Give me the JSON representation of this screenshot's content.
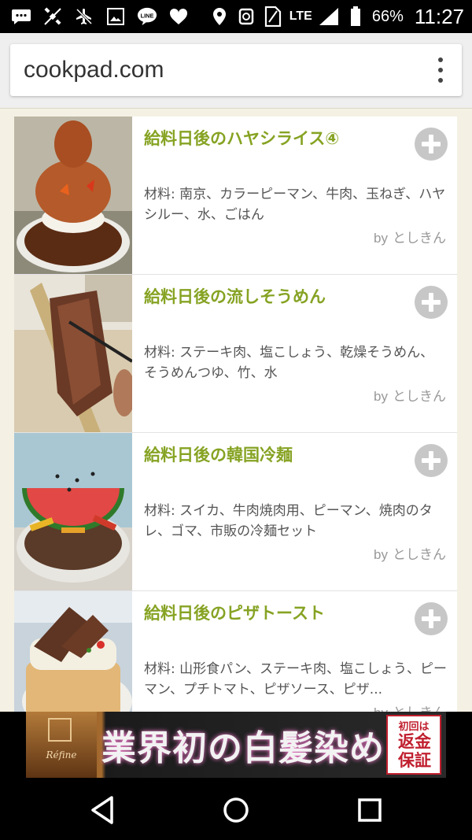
{
  "status_bar": {
    "network": "LTE",
    "battery": "66%",
    "time": "11:27",
    "icons_left": [
      "message-icon",
      "satellite-icon",
      "airplane-off-icon",
      "image-icon",
      "line-icon",
      "heart-icon"
    ],
    "icons_right": [
      "location-icon",
      "alarm-icon",
      "sim-icon",
      "signal-icon",
      "battery-icon"
    ]
  },
  "browser": {
    "url": "cookpad.com",
    "menu_icon": "overflow-menu-icon"
  },
  "recipes": [
    {
      "title": "給料日後のハヤシライス④",
      "ingredients": "材料: 南京、カラーピーマン、牛肉、玉ねぎ、ハヤシルー、水、ごはん",
      "by_label": "by",
      "author": "としきん"
    },
    {
      "title": "給料日後の流しそうめん",
      "ingredients": "材料: ステーキ肉、塩こしょう、乾燥そうめん、そうめんつゆ、竹、水",
      "by_label": "by",
      "author": "としきん"
    },
    {
      "title": "給料日後の韓国冷麺",
      "ingredients": "材料: スイカ、牛肉焼肉用、ピーマン、焼肉のタレ、ゴマ、市販の冷麺セット",
      "by_label": "by",
      "author": "としきん"
    },
    {
      "title": "給料日後のピザトースト",
      "ingredients": "材料: 山形食パン、ステーキ肉、塩こしょう、ピーマン、プチトマト、ピザソース、ピザ...",
      "by_label": "by",
      "author": "としきん"
    }
  ],
  "ad": {
    "brand": "Réfine",
    "headline": "業界初の白髪染め",
    "badge_small": "初回は",
    "badge_big": "返金保証"
  },
  "colors": {
    "title_green": "#86a323",
    "page_bg": "#f4f1e4"
  }
}
